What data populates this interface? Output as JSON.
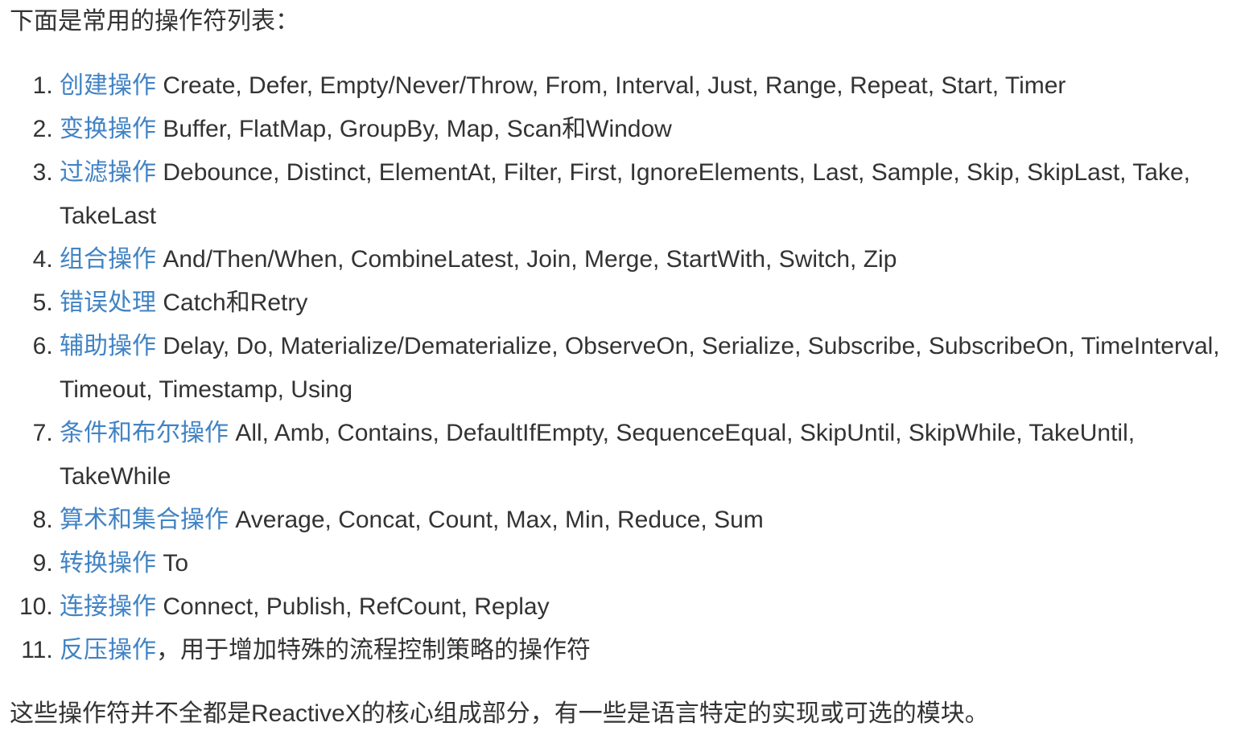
{
  "intro": "下面是常用的操作符列表：",
  "colors": {
    "link": "#4183c4",
    "text": "#333333"
  },
  "items": [
    {
      "category": "创建操作",
      "sep": " ",
      "desc": "Create, Defer, Empty/Never/Throw, From, Interval, Just, Range, Repeat, Start, Timer"
    },
    {
      "category": "变换操作",
      "sep": " ",
      "desc": "Buffer, FlatMap, GroupBy, Map, Scan和Window"
    },
    {
      "category": "过滤操作",
      "sep": " ",
      "desc": "Debounce, Distinct, ElementAt, Filter, First, IgnoreElements, Last, Sample, Skip, SkipLast, Take, TakeLast"
    },
    {
      "category": "组合操作",
      "sep": " ",
      "desc": "And/Then/When, CombineLatest, Join, Merge, StartWith, Switch, Zip"
    },
    {
      "category": "错误处理",
      "sep": " ",
      "desc": "Catch和Retry"
    },
    {
      "category": "辅助操作",
      "sep": " ",
      "desc": "Delay, Do, Materialize/Dematerialize, ObserveOn, Serialize, Subscribe, SubscribeOn, TimeInterval, Timeout, Timestamp, Using"
    },
    {
      "category": "条件和布尔操作",
      "sep": " ",
      "desc": "All, Amb, Contains, DefaultIfEmpty, SequenceEqual, SkipUntil, SkipWhile, TakeUntil, TakeWhile"
    },
    {
      "category": "算术和集合操作",
      "sep": " ",
      "desc": "Average, Concat, Count, Max, Min, Reduce, Sum"
    },
    {
      "category": "转换操作",
      "sep": " ",
      "desc": "To"
    },
    {
      "category": "连接操作",
      "sep": " ",
      "desc": "Connect, Publish, RefCount, Replay"
    },
    {
      "category": "反压操作",
      "sep": "，",
      "desc": "用于增加特殊的流程控制策略的操作符"
    }
  ],
  "outro": "这些操作符并不全都是ReactiveX的核心组成部分，有一些是语言特定的实现或可选的模块。"
}
